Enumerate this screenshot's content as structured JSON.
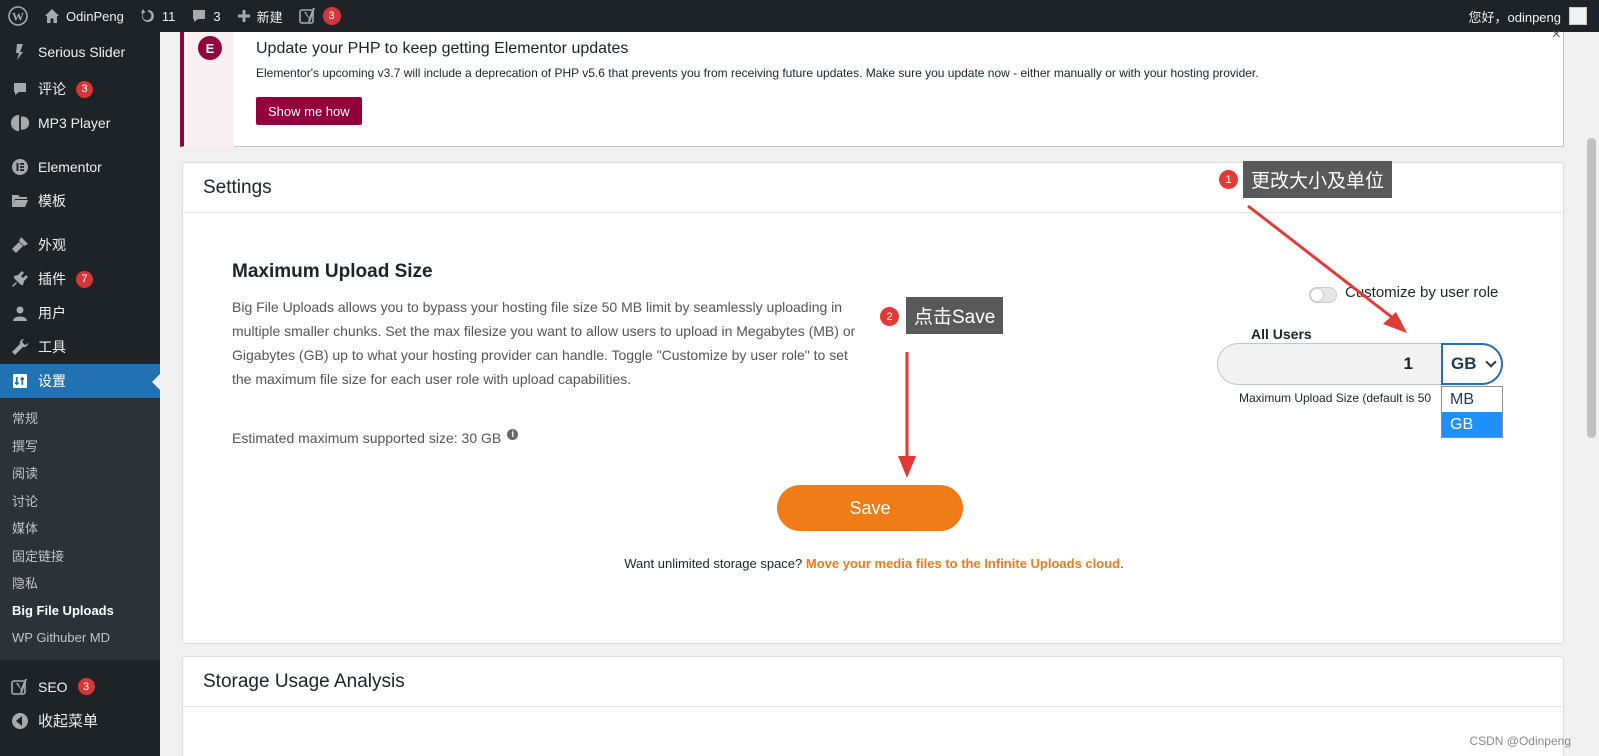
{
  "adminbar": {
    "site_name": "OdinPeng",
    "updates_count": "11",
    "comments_count": "3",
    "new_label": "新建",
    "seo_badge": "3",
    "greeting": "您好，odinpeng"
  },
  "sidebar": {
    "items": [
      {
        "label": "Serious Slider",
        "icon": "slider-icon"
      },
      {
        "label": "评论",
        "badge": "3",
        "icon": "comment-icon"
      },
      {
        "label": "MP3 Player",
        "icon": "mp3-icon"
      },
      {
        "label": "Elementor",
        "icon": "elementor-icon"
      },
      {
        "label": "模板",
        "icon": "folder-icon"
      },
      {
        "label": "外观",
        "icon": "brush-icon"
      },
      {
        "label": "插件",
        "badge": "7",
        "icon": "plugin-icon"
      },
      {
        "label": "用户",
        "icon": "user-icon"
      },
      {
        "label": "工具",
        "icon": "wrench-icon"
      },
      {
        "label": "设置",
        "icon": "settings-icon"
      }
    ],
    "submenu": [
      "常规",
      "撰写",
      "阅读",
      "讨论",
      "媒体",
      "固定链接",
      "隐私",
      "Big File Uploads",
      "WP Githuber MD"
    ],
    "seo_label": "SEO",
    "seo_badge": "3",
    "collapse_label": "收起菜单"
  },
  "notice": {
    "logo": "E",
    "title": "Update your PHP to keep getting Elementor updates",
    "text": "Elementor's upcoming v3.7 will include a deprecation of PHP v5.6 that prevents you from receiving future updates. Make sure you update now - either manually or with your hosting provider.",
    "button": "Show me how",
    "close": "×"
  },
  "settings": {
    "heading": "Settings",
    "title": "Maximum Upload Size",
    "description": "Big File Uploads allows you to bypass your hosting file size 50 MB limit by seamlessly uploading in multiple smaller chunks. Set the max filesize you want to allow users to upload in Megabytes (MB) or Gigabytes (GB) up to what your hosting provider can handle. Toggle \"Customize by user role\" to set the maximum file size for each user role with upload capabilities.",
    "estimate": "Estimated maximum supported size: 30 GB",
    "toggle_label": "Customize by user role",
    "all_users": "All Users",
    "size_value": "1",
    "unit_selected": "GB",
    "unit_options": [
      "MB",
      "GB"
    ],
    "help_text": "Maximum Upload Size (default is 50",
    "save": "Save",
    "promo_text": "Want unlimited storage space? ",
    "promo_link": "Move your media files to the Infinite Uploads cloud",
    "promo_end": "."
  },
  "storage": {
    "heading": "Storage Usage Analysis"
  },
  "annotations": {
    "a1_num": "1",
    "a1_text": "更改大小及单位",
    "a2_num": "2",
    "a2_text": "点击Save"
  },
  "watermark": "CSDN @Odinpeng",
  "colors": {
    "sidebar_bg": "#1d2327",
    "active_blue": "#2271b1",
    "elementor_maroon": "#93003c",
    "save_orange": "#f07c17",
    "annotation_red": "#e53935"
  }
}
